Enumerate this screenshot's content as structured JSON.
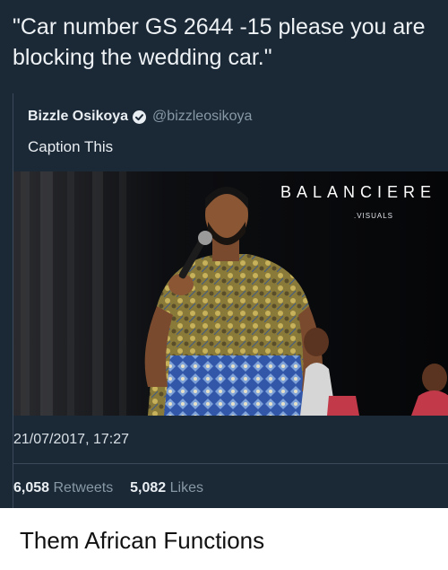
{
  "meme": {
    "top_caption": "\"Car number GS 2644 -15 please you are blocking the wedding car.\"",
    "bottom_caption": "Them African Functions"
  },
  "tweet": {
    "author_name": "Bizzle Osikoya",
    "handle": "@bizzleosikoya",
    "verified_icon": "verified-badge-icon",
    "text": "Caption This",
    "timestamp": "21/07/2017, 17:27",
    "retweets_count": "6,058",
    "retweets_label": "Retweets",
    "likes_count": "5,082",
    "likes_label": "Likes"
  },
  "photo": {
    "brand": "BALANCIERE",
    "brand_sub": ".VISUALS"
  },
  "colors": {
    "tweet_background": "#1b2836",
    "primary_text": "#e9eef2",
    "secondary_text": "#8899a6",
    "verified_blue": "#1da1f2"
  }
}
